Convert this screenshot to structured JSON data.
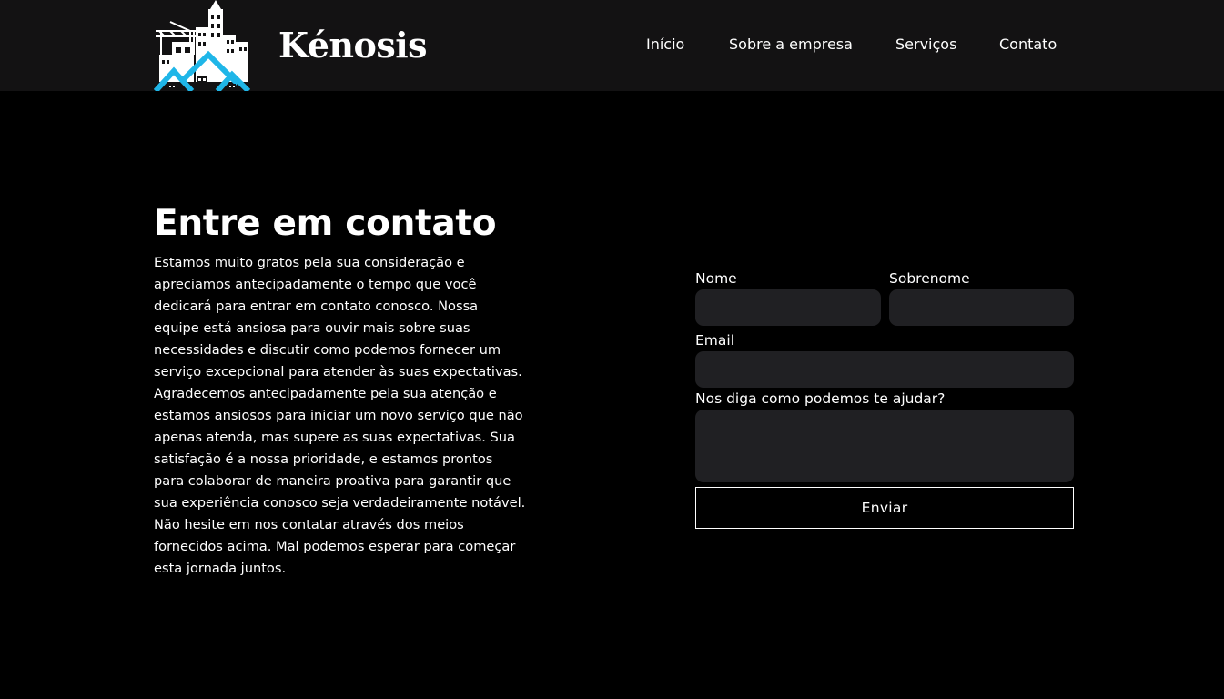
{
  "header": {
    "brand": "Kénosis",
    "nav": [
      {
        "label": "Início"
      },
      {
        "label": "Sobre a empresa"
      },
      {
        "label": "Serviços"
      },
      {
        "label": "Contato"
      }
    ]
  },
  "contact": {
    "title": "Entre em contato",
    "paragraph": "Estamos muito gratos pela sua consideração e apreciamos antecipadamente o tempo que você dedicará para entrar em contato conosco. Nossa equipe está ansiosa para ouvir mais sobre suas necessidades e discutir como podemos fornecer um serviço excepcional para atender às suas expectativas. Agradecemos antecipadamente pela sua atenção e estamos ansiosos para iniciar um novo serviço que não apenas atenda, mas supere as suas expectativas. Sua satisfação é a nossa prioridade, e estamos prontos para colaborar de maneira proativa para garantir que sua experiência conosco seja verdadeiramente notável. Não hesite em nos contatar através dos meios fornecidos acima. Mal podemos esperar para começar esta jornada juntos."
  },
  "form": {
    "first_name": {
      "label": "Nome",
      "value": "",
      "placeholder": ""
    },
    "last_name": {
      "label": "Sobrenome",
      "value": "",
      "placeholder": ""
    },
    "email": {
      "label": "Email",
      "value": "",
      "placeholder": ""
    },
    "message": {
      "label": "Nos diga como podemos te ajudar?",
      "value": "",
      "placeholder": ""
    },
    "submit_label": "Enviar"
  },
  "colors": {
    "page_background": "#000000",
    "header_background": "#131213",
    "field_background": "#202023",
    "text": "#ffffff",
    "logo_accent": "#1fb6e8"
  },
  "icons": {
    "logo": "construction-city-logo-icon"
  }
}
